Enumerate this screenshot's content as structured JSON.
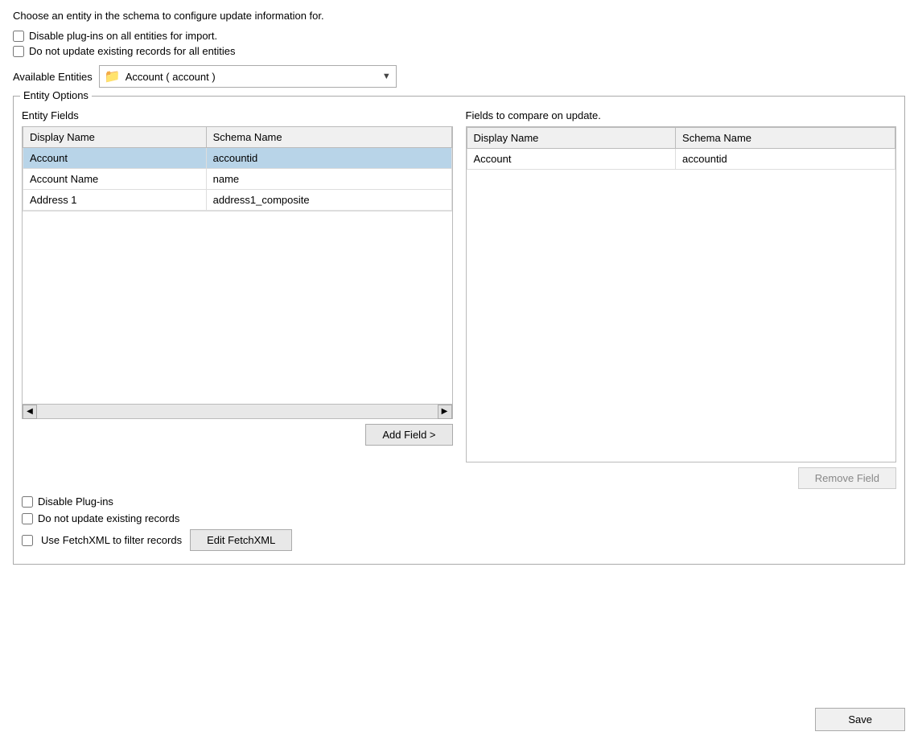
{
  "intro": {
    "text": "Choose an entity in the schema to configure update information for."
  },
  "global_checkboxes": {
    "disable_plugins": {
      "label": "Disable plug-ins on all entities for import.",
      "checked": false
    },
    "do_not_update_all": {
      "label": "Do not update existing records for all entities",
      "checked": false
    }
  },
  "available_entities": {
    "label": "Available Entities",
    "selected": "Account  (  account  )",
    "folder_icon": "📁"
  },
  "entity_options": {
    "legend": "Entity Options",
    "entity_fields_label": "Entity Fields",
    "compare_fields_label": "Fields to compare on update.",
    "left_table": {
      "columns": [
        {
          "key": "display_name",
          "label": "Display Name"
        },
        {
          "key": "schema_name",
          "label": "Schema Name"
        }
      ],
      "rows": [
        {
          "display_name": "Account",
          "schema_name": "accountid",
          "selected": true
        },
        {
          "display_name": "Account Name",
          "schema_name": "name",
          "selected": false
        },
        {
          "display_name": "Address 1",
          "schema_name": "address1_composite",
          "selected": false
        }
      ]
    },
    "right_table": {
      "columns": [
        {
          "key": "display_name",
          "label": "Display Name"
        },
        {
          "key": "schema_name",
          "label": "Schema Name"
        }
      ],
      "rows": [
        {
          "display_name": "Account",
          "schema_name": "accountid"
        }
      ]
    },
    "add_field_btn": "Add Field >",
    "remove_field_btn": "Remove Field"
  },
  "entity_bottom": {
    "disable_plugins": {
      "label": "Disable Plug-ins",
      "checked": false
    },
    "do_not_update": {
      "label": "Do not update existing records",
      "checked": false
    },
    "use_fetchxml": {
      "label": "Use FetchXML to filter records",
      "checked": false
    },
    "edit_fetchxml_btn": "Edit FetchXML"
  },
  "footer": {
    "save_btn": "Save"
  }
}
